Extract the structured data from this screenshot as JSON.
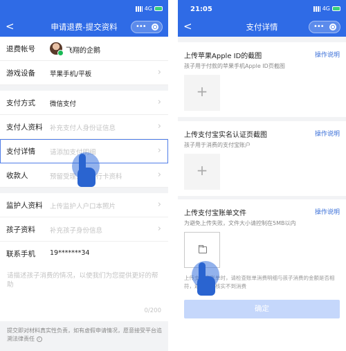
{
  "status": {
    "time": "21:05",
    "network": "4G"
  },
  "left": {
    "nav": {
      "back": "<",
      "title": "申请退费-提交资料"
    },
    "rows": [
      {
        "label": "退费帐号",
        "value": "飞翔的企鹅"
      },
      {
        "label": "游戏设备",
        "value": "苹果手机/平板"
      },
      {
        "label": "支付方式",
        "value": "微信支付"
      },
      {
        "label": "支付人资料",
        "value": "补充支付人身份证信息"
      },
      {
        "label": "支付详情",
        "value": "请添加支付明细"
      },
      {
        "label": "收款人",
        "value": "预留受理人的银行卡资料"
      },
      {
        "label": "监护人资料",
        "value": "上传监护人户口本照片"
      },
      {
        "label": "孩子资料",
        "value": "补充孩子身份信息"
      },
      {
        "label": "联系手机",
        "value": "19*******34"
      }
    ],
    "textarea": {
      "placeholder": "请描述孩子消费的情况，以使我们为您提供更好的帮助",
      "count": "0/200"
    },
    "notice": "提交即对材料真实性负责，如有虚假申请情况，愿意接受平台追溯法律责任"
  },
  "right": {
    "nav": {
      "back": "<",
      "title": "支付详情"
    },
    "sections": [
      {
        "title": "上传苹果Apple ID的截图",
        "op": "操作说明",
        "desc": "孩子用于付款的苹果手机Apple ID页截图"
      },
      {
        "title": "上传支付宝实名认证页截图",
        "op": "操作说明",
        "desc": "孩子用于消费的支付宝账户"
      },
      {
        "title": "上传支付宝账单文件",
        "op": "操作说明",
        "desc": "为避免上传失败，文件大小请控制在5MB以内"
      }
    ],
    "bottom_note": "上传支付宝账单时，请检查账单消费明细与孩子消费的金额是否相符，避免客服核实不到消费",
    "confirm": "确定"
  },
  "colors": {
    "brand_blue": "#2f6be6",
    "link": "#3a6fd8",
    "confirm_disabled": "#c5d7fb"
  }
}
